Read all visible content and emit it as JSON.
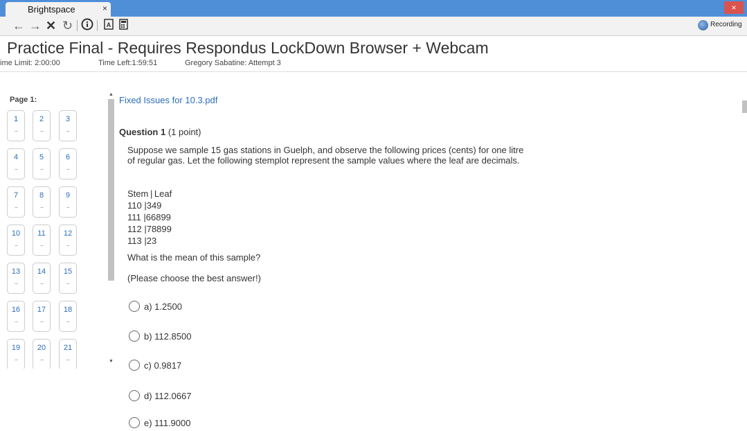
{
  "browser": {
    "tab_title": "Brightspace",
    "tab_close": "×",
    "window_close": "×",
    "recording_label": "Recording"
  },
  "header": {
    "title": "Practice Final - Requires Respondus LockDown Browser + Webcam",
    "time_limit": "ime Limit: 2:00:00",
    "time_left": "Time Left:1:59:51",
    "attempt": "Gregory Sabatine: Attempt 3"
  },
  "nav": {
    "page_label": "Page 1:",
    "questions": [
      {
        "num": "1",
        "status": "--"
      },
      {
        "num": "2",
        "status": "--"
      },
      {
        "num": "3",
        "status": "--"
      },
      {
        "num": "4",
        "status": "--"
      },
      {
        "num": "5",
        "status": "--"
      },
      {
        "num": "6",
        "status": "--"
      },
      {
        "num": "7",
        "status": "--"
      },
      {
        "num": "8",
        "status": "--"
      },
      {
        "num": "9",
        "status": "--"
      },
      {
        "num": "10",
        "status": "--"
      },
      {
        "num": "11",
        "status": "--"
      },
      {
        "num": "12",
        "status": "--"
      },
      {
        "num": "13",
        "status": "--"
      },
      {
        "num": "14",
        "status": "--"
      },
      {
        "num": "15",
        "status": "--"
      },
      {
        "num": "16",
        "status": "--"
      },
      {
        "num": "17",
        "status": "--"
      },
      {
        "num": "18",
        "status": "--"
      },
      {
        "num": "19",
        "status": "--"
      },
      {
        "num": "20",
        "status": "--"
      },
      {
        "num": "21",
        "status": "--"
      }
    ]
  },
  "main": {
    "file_link": "Fixed Issues for 10.3.pdf",
    "question_title": "Question 1",
    "question_points": "(1 point)",
    "question_text": "Suppose we sample 15 gas stations in Guelph, and observe the following prices (cents) for one litre of regular gas. Let the following stemplot represent the sample values where the leaf are decimals.",
    "stemplot": [
      "Stem | Leaf",
      "110  |349",
      "111  |66899",
      "112  |78899",
      "113  |23"
    ],
    "prompt": "What is the mean of this sample?",
    "hint": "(Please choose the best answer!)",
    "options": [
      "a) 1.2500",
      "b) 112.8500",
      "c) 0.9817",
      "d) 112.0667",
      "e) 111.9000"
    ]
  }
}
